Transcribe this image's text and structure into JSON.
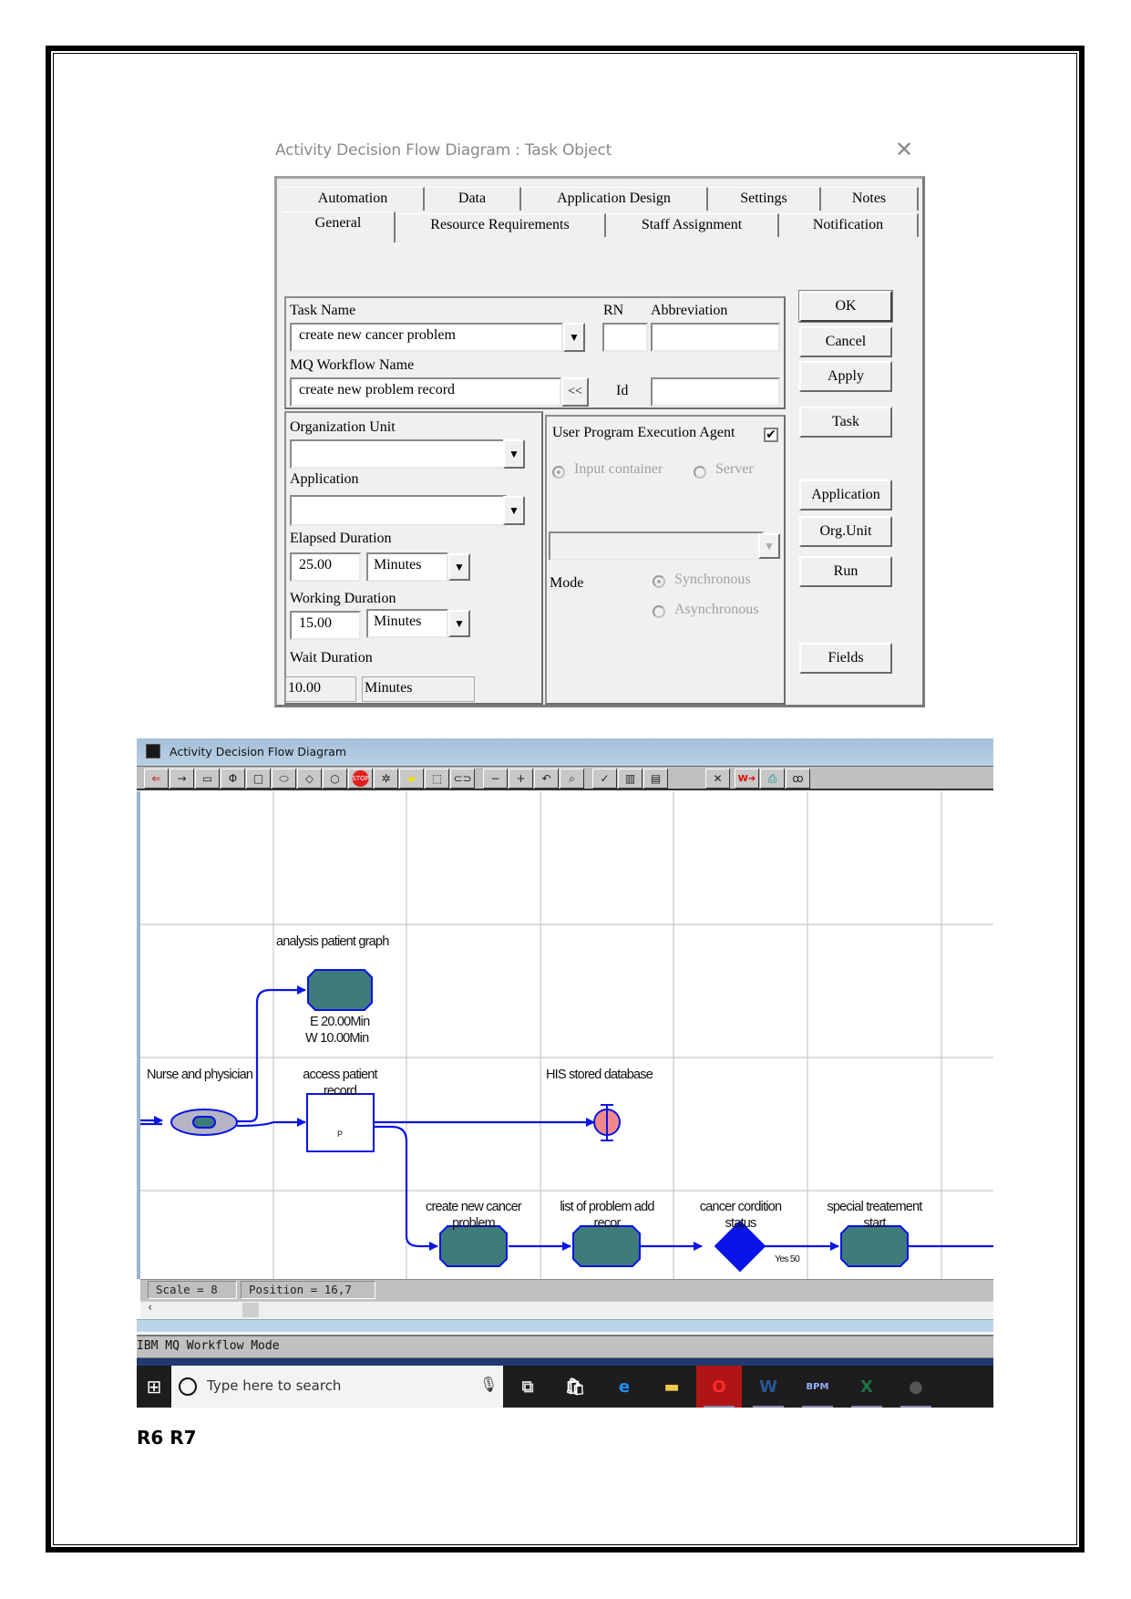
{
  "dialog": {
    "title": "Activity Decision Flow Diagram : Task  Object",
    "tabs_row1": [
      "Automation",
      "Data",
      "Application Design",
      "Settings",
      "Notes"
    ],
    "tabs_row2": [
      "General",
      "Resource Requirements",
      "Staff Assignment",
      "Notification"
    ],
    "active_tab": "General",
    "task_name_label": "Task Name",
    "task_name_value": "create new cancer problem",
    "rn_label": "RN",
    "rn_value": "",
    "abbreviation_label": "Abbreviation",
    "abbreviation_value": "",
    "mq_workflow_label": "MQ Workflow Name",
    "mq_workflow_value": "create new problem record",
    "mq_copy_button": "<<",
    "id_label": "Id",
    "id_value": "",
    "org_unit_label": "Organization Unit",
    "org_unit_value": "",
    "application_label": "Application",
    "application_value": "",
    "elapsed_label": "Elapsed Duration",
    "elapsed_value": "25.00",
    "elapsed_unit": "Minutes",
    "working_label": "Working Duration",
    "working_value": "15.00",
    "working_unit": "Minutes",
    "wait_label": "Wait Duration",
    "wait_value": "10.00",
    "wait_unit": "Minutes",
    "upea_label": "User Program Execution Agent",
    "upea_checked": true,
    "check_glyph": "✔",
    "input_container_label": "Input container",
    "server_label": "Server",
    "mode_label": "Mode",
    "synchronous_label": "Synchronous",
    "asynchronous_label": "Asynchronous",
    "dropdown_arrow": "▼",
    "buttons": [
      "OK",
      "Cancel",
      "Apply",
      "Task",
      "Application",
      "Org.Unit",
      "Run",
      "Fields"
    ],
    "close_glyph": "✕"
  },
  "diagram": {
    "window_title": "Activity Decision Flow Diagram",
    "toolbar_icons": [
      "select-arrow-icon",
      "connector-arrow-icon",
      "rounded-rect-icon",
      "split-icon",
      "square-icon",
      "ellipse-icon",
      "diamond-icon",
      "circle-icon",
      "stop-icon",
      "gear-icon",
      "note-icon",
      "selection-box-icon",
      "link-icon",
      "zoom-out-icon",
      "zoom-in-icon",
      "undo-icon",
      "find-icon",
      "check-icon",
      "ruler-icon",
      "folder-icon",
      "fit-to-screen-icon",
      "export-workflow-icon",
      "print-icon",
      "view-glasses-icon"
    ],
    "toolbar_glyphs": [
      "⇐",
      "→",
      "▭",
      "Φ",
      "□",
      "⬭",
      "◇",
      "○",
      "STOP",
      "✲",
      "▰",
      "⬚",
      "⊂⊃",
      "−",
      "+",
      "↶",
      "⌕",
      "✓",
      "▥",
      "▤",
      "✕",
      "W➔",
      "⎙",
      "ꝏ"
    ],
    "nodes": {
      "analysis": "analysis patient graph",
      "analysis_e": "E  20.00Min",
      "analysis_w": "W  10.00Min",
      "nurse": "Nurse and physician",
      "access_line1": "access patient",
      "access_line2": "record",
      "access_marker": "P",
      "his": "HIS stored database",
      "create_line1": "create new cancer",
      "create_line2": "problem",
      "list_line1": "list of problem add",
      "list_line2": "recor",
      "cancer_line1": "cancer cordition",
      "cancer_line2": "status",
      "special_line1": "special treatement",
      "special_line2": "start",
      "yes_label": "Yes 50"
    },
    "colors": {
      "flow": "#0a14e6",
      "task_fill": "#3f7b78",
      "decision_fill": "#0a14e6",
      "store_fill": "#f08a8a",
      "participant_fill": "#b4b4c4"
    },
    "status_scale": "Scale = 8",
    "status_position": "Position = 16,7",
    "scroll_left": "‹",
    "mode_text": "IBM MQ Workflow Mode"
  },
  "taskbar": {
    "start_glyph": "⊞",
    "search_placeholder": "Type here to search",
    "mic_glyph": "🎙",
    "apps": [
      {
        "name": "task-view",
        "glyph": "⧉",
        "color": "#dddddd",
        "bg": ""
      },
      {
        "name": "store",
        "glyph": "🛍",
        "color": "#ffffff",
        "bg": ""
      },
      {
        "name": "edge",
        "glyph": "e",
        "color": "#1e90ff",
        "bg": ""
      },
      {
        "name": "file-explorer",
        "glyph": "▬",
        "color": "#f2c94c",
        "bg": ""
      },
      {
        "name": "opera",
        "glyph": "O",
        "color": "#ff2b2b",
        "bg": "#b01515"
      },
      {
        "name": "word",
        "glyph": "W",
        "color": "#2b5797",
        "bg": ""
      },
      {
        "name": "bpm",
        "glyph": "BPM",
        "color": "#9bb0ff",
        "bg": ""
      },
      {
        "name": "excel",
        "glyph": "X",
        "color": "#1e7145",
        "bg": ""
      },
      {
        "name": "app",
        "glyph": "●",
        "color": "#555555",
        "bg": ""
      }
    ]
  },
  "caption": "R6 R7"
}
